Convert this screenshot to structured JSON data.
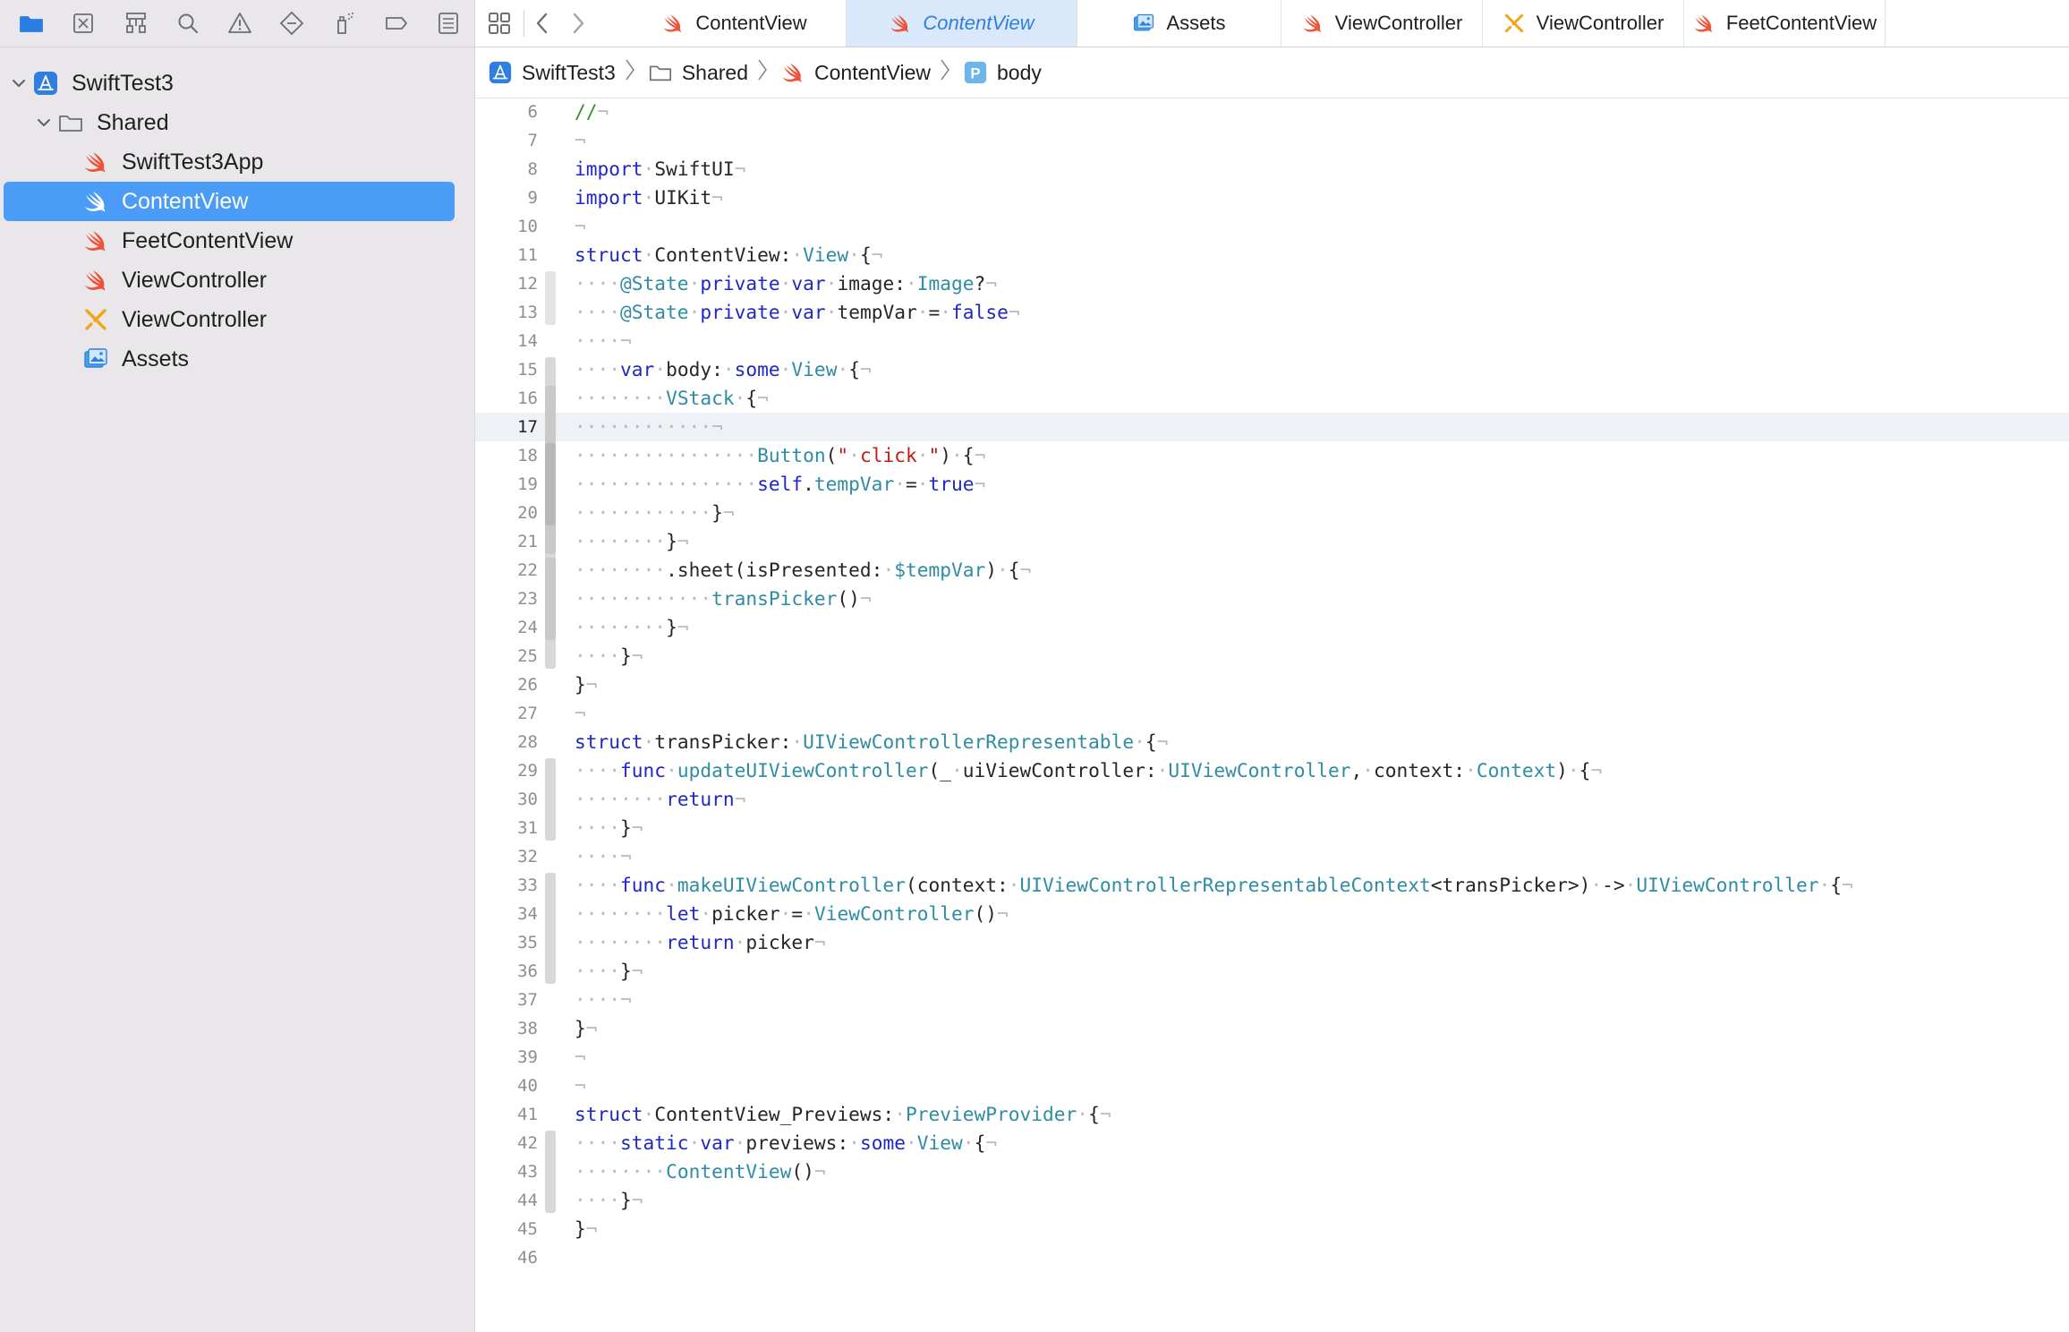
{
  "navigator": {
    "toolbar_icons": [
      "folder-icon",
      "source-control-icon",
      "symbol-hierarchy-icon",
      "search-icon",
      "warning-icon",
      "test-diamond-icon",
      "debug-spray-icon",
      "breakpoint-icon",
      "report-list-icon"
    ],
    "tree": [
      {
        "label": "SwiftTest3",
        "icon": "app-project-icon",
        "level": 0,
        "disclosure": "expanded"
      },
      {
        "label": "Shared",
        "icon": "folder-icon",
        "level": 1,
        "disclosure": "expanded"
      },
      {
        "label": "SwiftTest3App",
        "icon": "swift-file-icon",
        "level": 2
      },
      {
        "label": "ContentView",
        "icon": "swift-file-icon",
        "level": 2,
        "selected": true
      },
      {
        "label": "FeetContentView",
        "icon": "swift-file-icon",
        "level": 2
      },
      {
        "label": "ViewController",
        "icon": "swift-file-icon",
        "level": 2
      },
      {
        "label": "ViewController",
        "icon": "objc-header-icon",
        "level": 2
      },
      {
        "label": "Assets",
        "icon": "asset-catalog-icon",
        "level": 2
      }
    ]
  },
  "tabs": [
    {
      "label": "ContentView",
      "icon": "swift-file-icon"
    },
    {
      "label": "ContentView",
      "icon": "swift-file-icon",
      "active": true
    },
    {
      "label": "Assets",
      "icon": "asset-catalog-icon"
    },
    {
      "label": "ViewController",
      "icon": "swift-file-icon"
    },
    {
      "label": "ViewController",
      "icon": "objc-header-icon"
    },
    {
      "label": "FeetContentView",
      "icon": "swift-file-icon"
    }
  ],
  "jumpbar": [
    {
      "label": "SwiftTest3",
      "icon": "app-project-icon"
    },
    {
      "label": "Shared",
      "icon": "folder-icon"
    },
    {
      "label": "ContentView",
      "icon": "swift-file-icon"
    },
    {
      "label": "body",
      "icon": "property-icon",
      "icon_letter": "P"
    }
  ],
  "editor": {
    "current_line": 17,
    "lines": [
      {
        "n": 6,
        "html": "<span class=\"cm\">//</span><span class=\"inv\">¬</span>"
      },
      {
        "n": 7,
        "html": "<span class=\"inv\">¬</span>"
      },
      {
        "n": 8,
        "html": "<span class=\"kw\">import</span><span class=\"inv\">·</span>SwiftUI<span class=\"inv\">¬</span>"
      },
      {
        "n": 9,
        "html": "<span class=\"kw\">import</span><span class=\"inv\">·</span>UIKit<span class=\"inv\">¬</span>"
      },
      {
        "n": 10,
        "html": "<span class=\"inv\">¬</span>"
      },
      {
        "n": 11,
        "html": "<span class=\"kw\">struct</span><span class=\"inv\">·</span>ContentView:<span class=\"inv\">·</span><span class=\"ty\">View</span><span class=\"inv\">·</span>{<span class=\"inv\">¬</span>"
      },
      {
        "n": 12,
        "html": "<span class=\"inv\">····</span><span class=\"at\">@State</span><span class=\"inv\">·</span><span class=\"kw\">private</span><span class=\"inv\">·</span><span class=\"kw\">var</span><span class=\"inv\">·</span>image:<span class=\"inv\">·</span><span class=\"ty\">Image</span>?<span class=\"inv\">¬</span>"
      },
      {
        "n": 13,
        "html": "<span class=\"inv\">····</span><span class=\"at\">@State</span><span class=\"inv\">·</span><span class=\"kw\">private</span><span class=\"inv\">·</span><span class=\"kw\">var</span><span class=\"inv\">·</span>tempVar<span class=\"inv\">·</span>=<span class=\"inv\">·</span><span class=\"kw\">false</span><span class=\"inv\">¬</span>"
      },
      {
        "n": 14,
        "html": "<span class=\"inv\">····¬</span>"
      },
      {
        "n": 15,
        "html": "<span class=\"inv\">····</span><span class=\"kw\">var</span><span class=\"inv\">·</span>body:<span class=\"inv\">·</span><span class=\"kw\">some</span><span class=\"inv\">·</span><span class=\"ty\">View</span><span class=\"inv\">·</span>{<span class=\"inv\">¬</span>"
      },
      {
        "n": 16,
        "html": "<span class=\"inv\">········</span><span class=\"fn\">VStack</span><span class=\"inv\">·</span>{<span class=\"inv\">¬</span>"
      },
      {
        "n": 17,
        "html": "<span class=\"inv\">············¬</span>"
      },
      {
        "n": 18,
        "html": "<span class=\"inv\">················</span><span class=\"fn\">Button</span>(<span class=\"str\">\"<span class=\"inv\">·</span>click<span class=\"inv\">·</span>\"</span>)<span class=\"inv\">·</span>{<span class=\"inv\">¬</span>"
      },
      {
        "n": 19,
        "html": "<span class=\"inv\">················</span><span class=\"kw\">self</span>.<span class=\"ty\">tempVar</span><span class=\"inv\">·</span>=<span class=\"inv\">·</span><span class=\"kw\">true</span><span class=\"inv\">¬</span>"
      },
      {
        "n": 20,
        "html": "<span class=\"inv\">············</span>}<span class=\"inv\">¬</span>"
      },
      {
        "n": 21,
        "html": "<span class=\"inv\">········</span>}<span class=\"inv\">¬</span>"
      },
      {
        "n": 22,
        "html": "<span class=\"inv\">········</span>.sheet(isPresented:<span class=\"inv\">·</span><span class=\"ty\">$tempVar</span>)<span class=\"inv\">·</span>{<span class=\"inv\">¬</span>"
      },
      {
        "n": 23,
        "html": "<span class=\"inv\">············</span><span class=\"fn\">transPicker</span>()<span class=\"inv\">¬</span>"
      },
      {
        "n": 24,
        "html": "<span class=\"inv\">········</span>}<span class=\"inv\">¬</span>"
      },
      {
        "n": 25,
        "html": "<span class=\"inv\">····</span>}<span class=\"inv\">¬</span>"
      },
      {
        "n": 26,
        "html": "}<span class=\"inv\">¬</span>"
      },
      {
        "n": 27,
        "html": "<span class=\"inv\">¬</span>"
      },
      {
        "n": 28,
        "html": "<span class=\"kw\">struct</span><span class=\"inv\">·</span>transPicker:<span class=\"inv\">·</span><span class=\"ty\">UIViewControllerRepresentable</span><span class=\"inv\">·</span>{<span class=\"inv\">¬</span>"
      },
      {
        "n": 29,
        "html": "<span class=\"inv\">····</span><span class=\"kw\">func</span><span class=\"inv\">·</span><span class=\"fn\">updateUIViewController</span>(_<span class=\"inv\">·</span>uiViewController:<span class=\"inv\">·</span><span class=\"ty\">UIViewController</span>,<span class=\"inv\">·</span>context:<span class=\"inv\">·</span><span class=\"ty\">Context</span>)<span class=\"inv\">·</span>{<span class=\"inv\">¬</span>"
      },
      {
        "n": 30,
        "html": "<span class=\"inv\">········</span><span class=\"kw\">return</span><span class=\"inv\">¬</span>"
      },
      {
        "n": 31,
        "html": "<span class=\"inv\">····</span>}<span class=\"inv\">¬</span>"
      },
      {
        "n": 32,
        "html": "<span class=\"inv\">····¬</span>"
      },
      {
        "n": 33,
        "html": "<span class=\"inv\">····</span><span class=\"kw\">func</span><span class=\"inv\">·</span><span class=\"fn\">makeUIViewController</span>(context:<span class=\"inv\">·</span><span class=\"ty\">UIViewControllerRepresentableContext</span>&lt;transPicker&gt;)<span class=\"inv\">·</span>-&gt;<span class=\"inv\">·</span><span class=\"ty\">UIViewController</span><span class=\"inv\">·</span>{<span class=\"inv\">¬</span>"
      },
      {
        "n": 34,
        "html": "<span class=\"inv\">········</span><span class=\"kw\">let</span><span class=\"inv\">·</span>picker<span class=\"inv\">·</span>=<span class=\"inv\">·</span><span class=\"fn\">ViewController</span>()<span class=\"inv\">¬</span>"
      },
      {
        "n": 35,
        "html": "<span class=\"inv\">········</span><span class=\"kw\">return</span><span class=\"inv\">·</span>picker<span class=\"inv\">¬</span>"
      },
      {
        "n": 36,
        "html": "<span class=\"inv\">····</span>}<span class=\"inv\">¬</span>"
      },
      {
        "n": 37,
        "html": "<span class=\"inv\">····¬</span>"
      },
      {
        "n": 38,
        "html": "}<span class=\"inv\">¬</span>"
      },
      {
        "n": 39,
        "html": "<span class=\"inv\">¬</span>"
      },
      {
        "n": 40,
        "html": "<span class=\"inv\">¬</span>"
      },
      {
        "n": 41,
        "html": "<span class=\"kw\">struct</span><span class=\"inv\">·</span>ContentView_Previews:<span class=\"inv\">·</span><span class=\"ty\">PreviewProvider</span><span class=\"inv\">·</span>{<span class=\"inv\">¬</span>"
      },
      {
        "n": 42,
        "html": "<span class=\"inv\">····</span><span class=\"kw\">static</span><span class=\"inv\">·</span><span class=\"kw\">var</span><span class=\"inv\">·</span>previews:<span class=\"inv\">·</span><span class=\"kw\">some</span><span class=\"inv\">·</span><span class=\"ty\">View</span><span class=\"inv\">·</span>{<span class=\"inv\">¬</span>"
      },
      {
        "n": 43,
        "html": "<span class=\"inv\">········</span><span class=\"fn\">ContentView</span>()<span class=\"inv\">¬</span>"
      },
      {
        "n": 44,
        "html": "<span class=\"inv\">····</span>}<span class=\"inv\">¬</span>"
      },
      {
        "n": 45,
        "html": "}<span class=\"inv\">¬</span>"
      },
      {
        "n": 46,
        "html": ""
      }
    ]
  },
  "colors": {
    "selection": "#4a9cf6",
    "active_tab_bg": "#d9e8fb",
    "active_tab_text": "#2f7fe0",
    "keyword": "#1f27c9",
    "type": "#2e8ca3",
    "string": "#c41a16",
    "comment": "#3d8b2f",
    "swift_orange": "#f05138"
  }
}
